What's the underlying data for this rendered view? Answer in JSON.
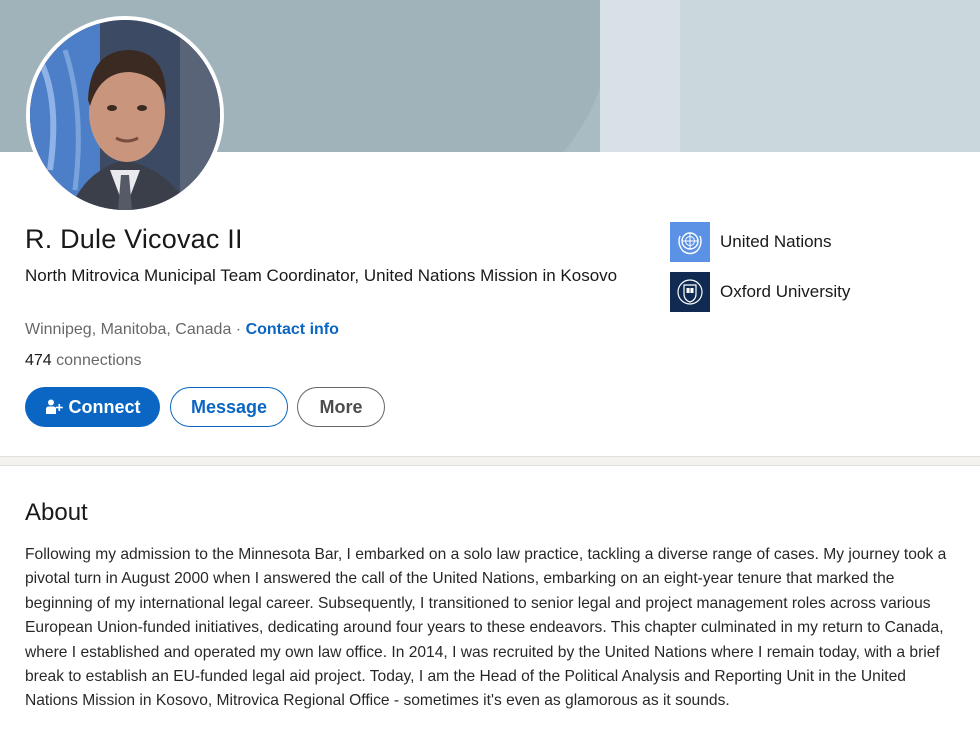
{
  "profile": {
    "name": "R. Dule Vicovac II",
    "headline": "North Mitrovica Municipal Team Coordinator, United Nations Mission in Kosovo",
    "location": "Winnipeg, Manitoba, Canada",
    "separator": " · ",
    "contact_info": "Contact info",
    "connections_count": "474",
    "connections_label": " connections"
  },
  "actions": {
    "connect_label": "Connect",
    "message_label": "Message",
    "more_label": "More"
  },
  "organizations": [
    {
      "name": "United Nations",
      "icon": "un-logo-icon"
    },
    {
      "name": "Oxford University",
      "icon": "oxford-logo-icon"
    }
  ],
  "about": {
    "title": "About",
    "text": "Following my admission to the Minnesota Bar, I embarked on a solo law practice, tackling a diverse range of cases. My journey took a pivotal turn in August 2000 when I answered the call of the United Nations, embarking on an eight-year tenure that marked the beginning of my international legal career. Subsequently, I transitioned to senior legal and project management roles across various European Union-funded initiatives, dedicating around four years to these endeavors. This chapter culminated in my return to Canada, where I established and operated my own law office. In 2014, I was recruited by the United Nations where I remain today, with a brief break to establish an EU-funded legal aid project. Today, I am the Head of the Political Analysis and Reporting Unit in the United Nations Mission in Kosovo, Mitrovica Regional Office - sometimes it's even as glamorous as it sounds."
  },
  "colors": {
    "primary": "#0a66c2",
    "un_blue": "#5b92e5",
    "oxford_navy": "#102a52"
  }
}
